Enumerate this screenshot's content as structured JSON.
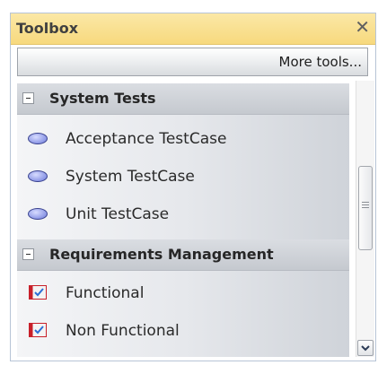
{
  "toolbox": {
    "title": "Toolbox",
    "close_glyph": "✕",
    "more_tools": "More tools...",
    "categories": [
      {
        "label": "System Tests",
        "items": [
          {
            "label": "Acceptance TestCase",
            "icon": "use-case-oval-icon"
          },
          {
            "label": "System TestCase",
            "icon": "use-case-oval-icon"
          },
          {
            "label": "Unit TestCase",
            "icon": "use-case-oval-icon"
          }
        ]
      },
      {
        "label": "Requirements Management",
        "items": [
          {
            "label": "Functional",
            "icon": "requirement-check-icon"
          },
          {
            "label": "Non Functional",
            "icon": "requirement-check-icon"
          }
        ]
      }
    ]
  },
  "colors": {
    "titlebar": "#f7d97e",
    "oval_fill": "#8c97e6",
    "requirement_red": "#c8202a"
  }
}
